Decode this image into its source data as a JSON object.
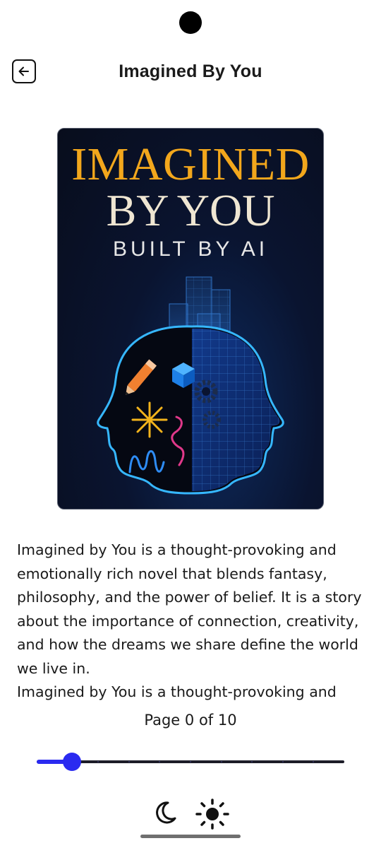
{
  "header": {
    "title": "Imagined By You",
    "back_icon": "arrow-left-icon"
  },
  "cover": {
    "line1": "IMAGINED",
    "line2": "BY YOU",
    "line3": "BUILT BY AI"
  },
  "description": {
    "paragraph1": "Imagined by You is a thought-provoking and emotionally rich novel that blends fantasy, philosophy, and the power of belief. It is a story about the importance of connection, creativity, and how the dreams we share define the world we live in.",
    "paragraph2": "Imagined by You is a thought-provoking and"
  },
  "pagination": {
    "label": "Page 0 of 10",
    "current": 0,
    "total": 10,
    "slider_position": 0.115
  },
  "theme": {
    "dark_icon": "moon-icon",
    "light_icon": "sun-icon"
  },
  "colors": {
    "accent": "#2a2af0",
    "cover_title": "#f2a71c",
    "cover_background": "#0a1430"
  }
}
